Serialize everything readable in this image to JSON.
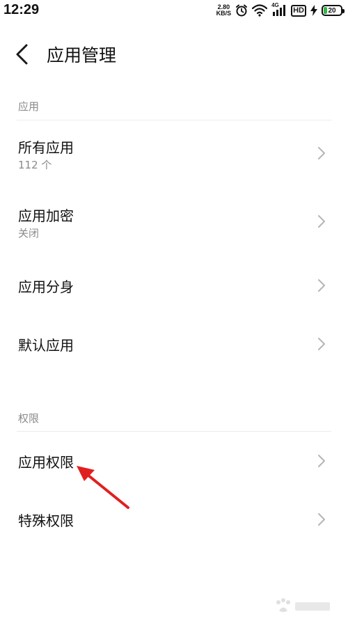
{
  "status_bar": {
    "time": "12:29",
    "speed_value": "2.80",
    "speed_unit": "KB/S",
    "network": "4G",
    "hd": "HD",
    "battery": "20",
    "battery_fraction": 0.2
  },
  "header": {
    "title": "应用管理"
  },
  "sections": [
    {
      "header": "应用",
      "items": [
        {
          "label": "所有应用",
          "sub": "112 个"
        },
        {
          "label": "应用加密",
          "sub": "关闭"
        },
        {
          "label": "应用分身",
          "sub": ""
        },
        {
          "label": "默认应用",
          "sub": ""
        }
      ]
    },
    {
      "header": "权限",
      "items": [
        {
          "label": "应用权限",
          "sub": ""
        },
        {
          "label": "特殊权限",
          "sub": ""
        }
      ]
    }
  ],
  "colors": {
    "annotation_arrow": "#e02020",
    "battery_fill": "#2db84a"
  },
  "icons": {
    "back": "back-arrow-icon",
    "chevron": "chevron-right-icon",
    "alarm": "alarm-clock-icon",
    "wifi": "wifi-icon",
    "signal": "signal-icon",
    "charging": "charging-bolt-icon"
  }
}
